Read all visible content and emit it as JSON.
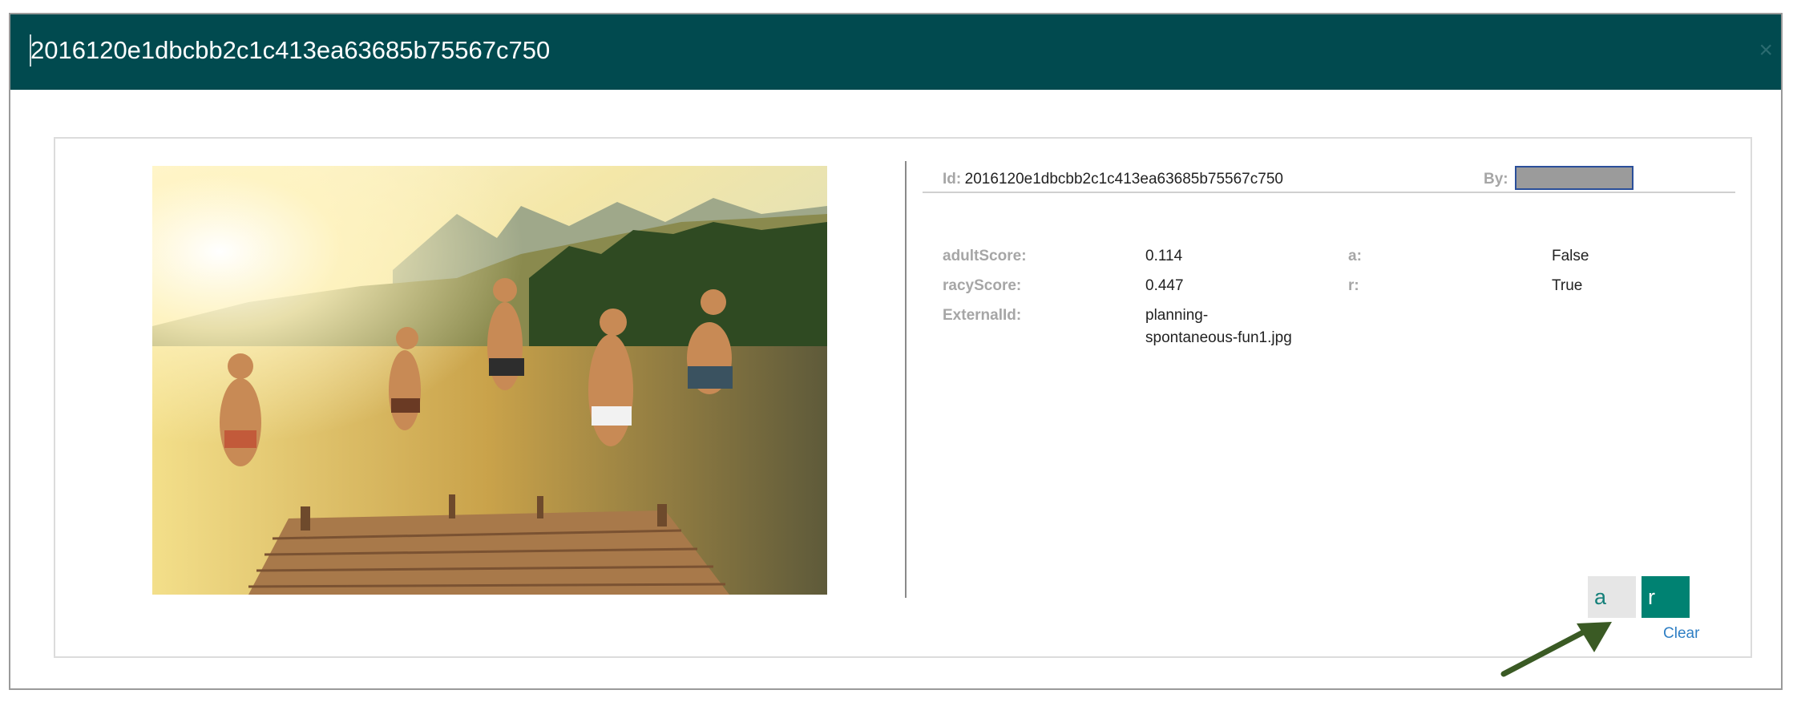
{
  "header": {
    "title": "2016120e1dbcbb2c1c413ea63685b75567c750",
    "close_label": "×"
  },
  "details": {
    "id_label": "Id:",
    "id_value": "2016120e1dbcbb2c1c413ea63685b75567c750",
    "by_label": "By:",
    "fields": [
      {
        "label": "adultScore:",
        "value": "0.114"
      },
      {
        "label": "racyScore:",
        "value": "0.447"
      },
      {
        "label": "ExternalId:",
        "value_line1": "planning-",
        "value_line2": "spontaneous-fun1.jpg"
      }
    ],
    "tags": [
      {
        "label": "a:",
        "value": "False"
      },
      {
        "label": "r:",
        "value": "True"
      }
    ]
  },
  "actions": {
    "a_label": "a",
    "r_label": "r",
    "clear_label": "Clear"
  },
  "colors": {
    "header_bg": "#014a4f",
    "accent": "#008272",
    "link": "#2f7fc4",
    "annotation_arrow": "#3a5a24"
  },
  "image": {
    "description_icon": "photo-people-jumping-into-lake"
  }
}
